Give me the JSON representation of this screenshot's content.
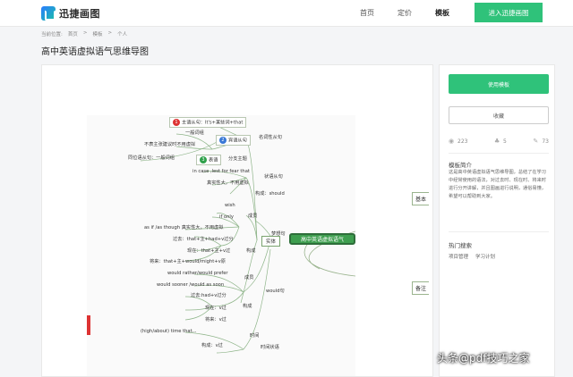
{
  "header": {
    "logo_text": "迅捷画图",
    "nav": [
      {
        "label": "首页"
      },
      {
        "label": "定价"
      },
      {
        "label": "模板"
      }
    ],
    "cta_label": "进入迅捷画图"
  },
  "breadcrumb": {
    "prefix": "当前位置:",
    "items": [
      "首页",
      ">",
      "模板",
      ">",
      "个人"
    ]
  },
  "page_title": "高中英语虚拟语气思维导图",
  "mindmap": {
    "centre": "高中英语虚拟语气",
    "centre_left": "实体",
    "right_nodes": [
      "基本",
      "备注"
    ],
    "nodes": [
      {
        "id": "n1",
        "text": "主语从句：It's+某些词+that",
        "badge": "1",
        "badge_color": "#d33"
      },
      {
        "id": "n2",
        "text": "名词性从句"
      },
      {
        "id": "n3",
        "text": "一般词组"
      },
      {
        "id": "n4",
        "text": "宾语从句",
        "badge": "2",
        "badge_color": "#3a78d6"
      },
      {
        "id": "n5",
        "text": "不表主张建议时不用虚拟"
      },
      {
        "id": "n6",
        "text": "同位语从句：一般词组"
      },
      {
        "id": "n7",
        "text": "表语",
        "badge": "3",
        "badge_color": "#2fa04a"
      },
      {
        "id": "n8",
        "text": "分支主题"
      },
      {
        "id": "n9",
        "text": "in case ,lest for fear that"
      },
      {
        "id": "n10",
        "text": "状语从句"
      },
      {
        "id": "n11",
        "text": "真实性大，不用虚拟"
      },
      {
        "id": "n12",
        "text": "构成：should"
      },
      {
        "id": "n13",
        "text": "wish"
      },
      {
        "id": "n14",
        "text": "if only"
      },
      {
        "id": "n15",
        "text": "成员"
      },
      {
        "id": "n16",
        "text": "as if /as though 真实性大，不用虚拟"
      },
      {
        "id": "n17",
        "text": "梦想句"
      },
      {
        "id": "n18",
        "text": "过去：that+主+had+v过分"
      },
      {
        "id": "n19",
        "text": "现在：that+主+v过"
      },
      {
        "id": "n20",
        "text": "构成"
      },
      {
        "id": "n21",
        "text": "将来：that+主+would/might+v原"
      },
      {
        "id": "n22",
        "text": "would rather/would prefer"
      },
      {
        "id": "n23",
        "text": "成员"
      },
      {
        "id": "n24",
        "text": "would sooner /would as soon"
      },
      {
        "id": "n25",
        "text": "would句"
      },
      {
        "id": "n26",
        "text": "过去:had+v过分"
      },
      {
        "id": "n27",
        "text": "构成"
      },
      {
        "id": "n28",
        "text": "现在：v过"
      },
      {
        "id": "n29",
        "text": "将来：v过"
      },
      {
        "id": "n30",
        "text": "(high/about) time that..."
      },
      {
        "id": "n31",
        "text": "时间"
      },
      {
        "id": "n32",
        "text": "构成：v过"
      },
      {
        "id": "n33",
        "text": "时间状语"
      }
    ]
  },
  "sidebar": {
    "use_label": "使用模板",
    "fav_label": "收藏",
    "stats": {
      "views": "223",
      "likes": "5",
      "uses": "73"
    },
    "intro_title": "模板简介",
    "intro_text": "这是高中英语虚拟语气思维导图，总结了在学习中经常使用的语法，对过去时、现在时、将来时进行分开讲解，并且图画进行说明，通俗易懂，希望可以帮助到大家。",
    "hot_title": "热门搜索",
    "tags": [
      "项目管理",
      "学习计划"
    ]
  },
  "watermark": "头条@pdf技巧之家",
  "colors": {
    "accent": "#2fc27a",
    "map_green": "#3e9e4f"
  }
}
